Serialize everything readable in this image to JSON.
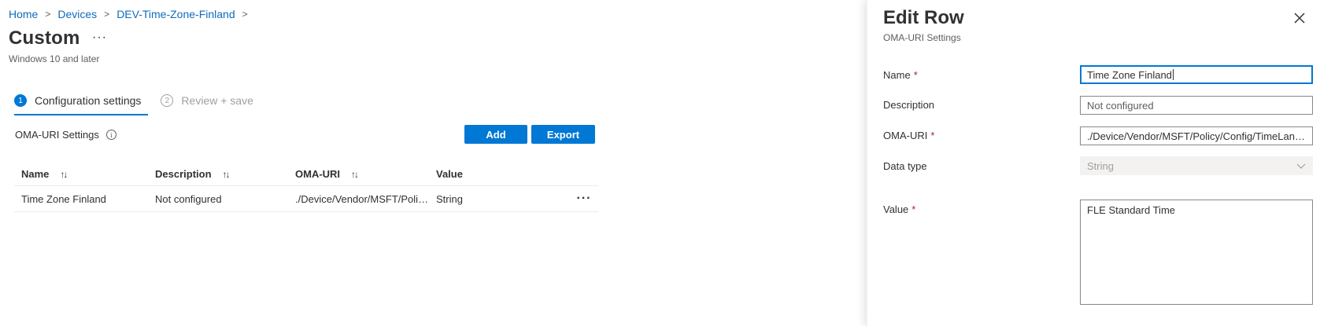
{
  "breadcrumb": [
    {
      "label": "Home"
    },
    {
      "label": "Devices"
    },
    {
      "label": "DEV-Time-Zone-Finland"
    }
  ],
  "page": {
    "title": "Custom",
    "more": "···",
    "subtitle": "Windows 10 and later"
  },
  "steps": [
    {
      "number": "1",
      "label": "Configuration settings",
      "state": "active"
    },
    {
      "number": "2",
      "label": "Review + save",
      "state": "inactive"
    }
  ],
  "settings": {
    "section_label": "OMA-URI Settings",
    "info_icon": "i",
    "add_label": "Add",
    "export_label": "Export"
  },
  "table": {
    "columns": [
      {
        "label": "Name",
        "sortable": true
      },
      {
        "label": "Description",
        "sortable": true
      },
      {
        "label": "OMA-URI",
        "sortable": true
      },
      {
        "label": "Value",
        "sortable": false
      }
    ],
    "rows": [
      {
        "name": "Time Zone Finland",
        "description": "Not configured",
        "oma_uri": "./Device/Vendor/MSFT/Policy/Config/TimeLanguageSettings/ConfigureTimeZone",
        "value": "String",
        "more": "···"
      }
    ]
  },
  "panel": {
    "title": "Edit Row",
    "subtitle": "OMA-URI Settings",
    "fields": {
      "name": {
        "label": "Name",
        "required": "*",
        "value": "Time Zone Finland"
      },
      "description": {
        "label": "Description",
        "value": "Not configured"
      },
      "oma_uri": {
        "label": "OMA-URI",
        "required": "*",
        "value": "./Device/Vendor/MSFT/Policy/Config/TimeLanguageSettings/ConfigureTimeZone"
      },
      "data_type": {
        "label": "Data type",
        "value": "String"
      },
      "value": {
        "label": "Value",
        "required": "*",
        "value": "FLE Standard Time"
      }
    }
  },
  "colors": {
    "accent": "#0078d4",
    "link": "#0f6cbd",
    "required": "#a4262c"
  }
}
